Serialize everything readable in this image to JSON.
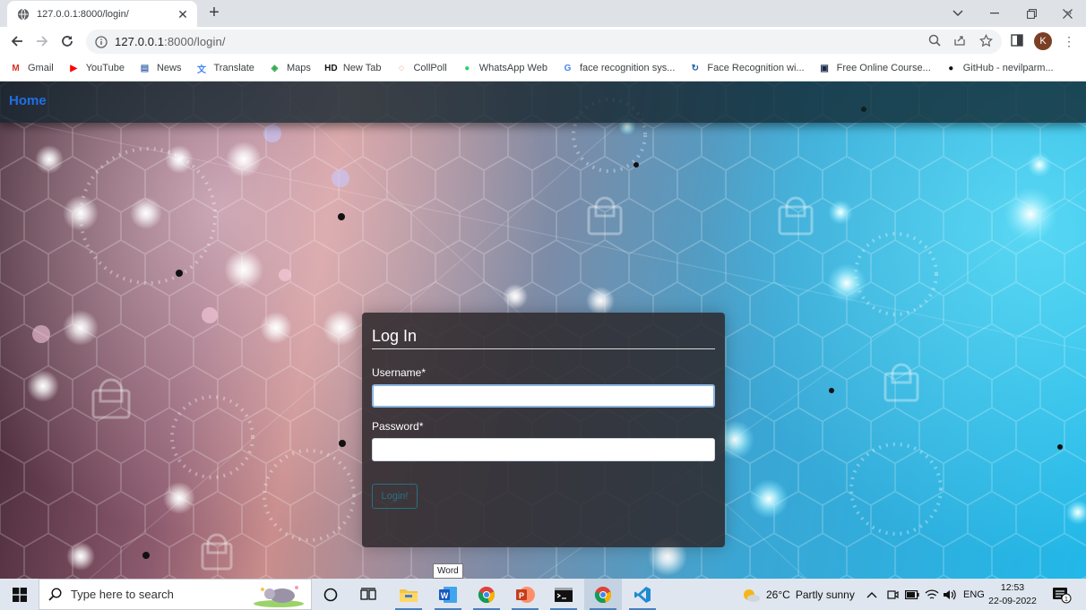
{
  "browser": {
    "tab_title": "127.0.0.1:8000/login/",
    "url_host": "127.0.0.1",
    "url_rest": ":8000/login/",
    "profile_initial": "K",
    "bookmarks": [
      {
        "label": "Gmail",
        "icon": "gmail-icon",
        "color": "#d93025",
        "glyph": "M"
      },
      {
        "label": "YouTube",
        "icon": "youtube-icon",
        "color": "#ff0000",
        "glyph": "▶"
      },
      {
        "label": "News",
        "icon": "news-icon",
        "color": "#4a6fb5",
        "glyph": "▤"
      },
      {
        "label": "Translate",
        "icon": "translate-icon",
        "color": "#4285f4",
        "glyph": "文"
      },
      {
        "label": "Maps",
        "icon": "maps-icon",
        "color": "#34a853",
        "glyph": "◈"
      },
      {
        "label": "New Tab",
        "icon": "hd-icon",
        "color": "#111111",
        "glyph": "HD"
      },
      {
        "label": "CollPoll",
        "icon": "collpoll-icon",
        "color": "#e4572e",
        "glyph": "◌"
      },
      {
        "label": "WhatsApp Web",
        "icon": "whatsapp-icon",
        "color": "#25d366",
        "glyph": "●"
      },
      {
        "label": "face recognition sys...",
        "icon": "google-icon",
        "color": "#4285f4",
        "glyph": "G"
      },
      {
        "label": "Face Recognition wi...",
        "icon": "edge-icon",
        "color": "#1f5fa8",
        "glyph": "↻"
      },
      {
        "label": "Free Online Course...",
        "icon": "course-icon",
        "color": "#1a2a4a",
        "glyph": "▣"
      },
      {
        "label": "GitHub - nevilparm...",
        "icon": "github-icon",
        "color": "#111111",
        "glyph": "●"
      }
    ]
  },
  "page": {
    "nav_home": "Home",
    "login": {
      "title": "Log In",
      "username_label": "Username*",
      "username_value": "",
      "password_label": "Password*",
      "password_value": "",
      "button_label": "Login!"
    },
    "tooltip": "Word"
  },
  "taskbar": {
    "search_placeholder": "Type here to search",
    "weather_temp": "26°C",
    "weather_text": "Partly sunny",
    "language": "ENG",
    "time": "12:53",
    "date": "22-09-2022",
    "notification_count": "1"
  },
  "colors": {
    "accent_link": "#1f6fe5",
    "login_button": "#17a2b8"
  }
}
